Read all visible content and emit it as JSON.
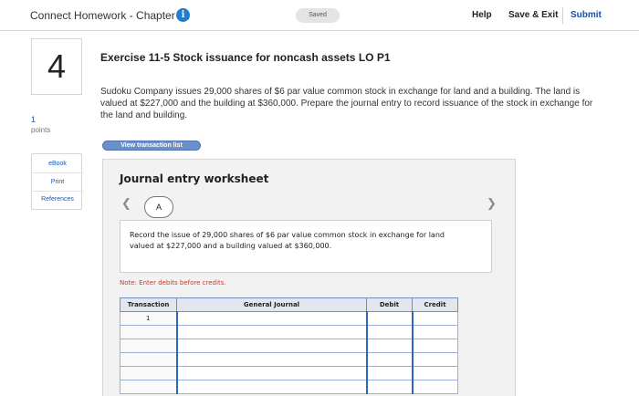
{
  "topbar": {
    "title": "Connect Homework - Chapter 11",
    "info_icon": "info-icon",
    "saved_label": "Saved",
    "help_label": "Help",
    "save_exit_label": "Save & Exit",
    "submit_label": "Submit"
  },
  "question": {
    "number": "4",
    "points_value": "1",
    "points_label": "points",
    "title": "Exercise 11-5 Stock issuance for noncash assets LO P1",
    "text": "Sudoku Company issues 29,000 shares of $6 par value common stock in exchange for land and a building. The land is valued at $227,000 and the building at $360,000. Prepare the journal entry to record issuance of the stock in exchange for the land and building."
  },
  "resources": {
    "ebook_label": "eBook",
    "print_label": "Print",
    "references_label": "References"
  },
  "view_transaction_list_label": "View transaction list",
  "worksheet": {
    "title": "Journal entry worksheet",
    "tab_label": "A",
    "instruction": "Record the issue of 29,000 shares of $6 par value common stock in exchange for land valued at $227,000 and a building valued at $360,000.",
    "note": "Note: Enter debits before credits.",
    "columns": [
      "Transaction",
      "General Journal",
      "Debit",
      "Credit"
    ],
    "rows": [
      {
        "transaction": "1"
      },
      {
        "transaction": ""
      },
      {
        "transaction": ""
      },
      {
        "transaction": ""
      },
      {
        "transaction": ""
      },
      {
        "transaction": ""
      }
    ]
  }
}
